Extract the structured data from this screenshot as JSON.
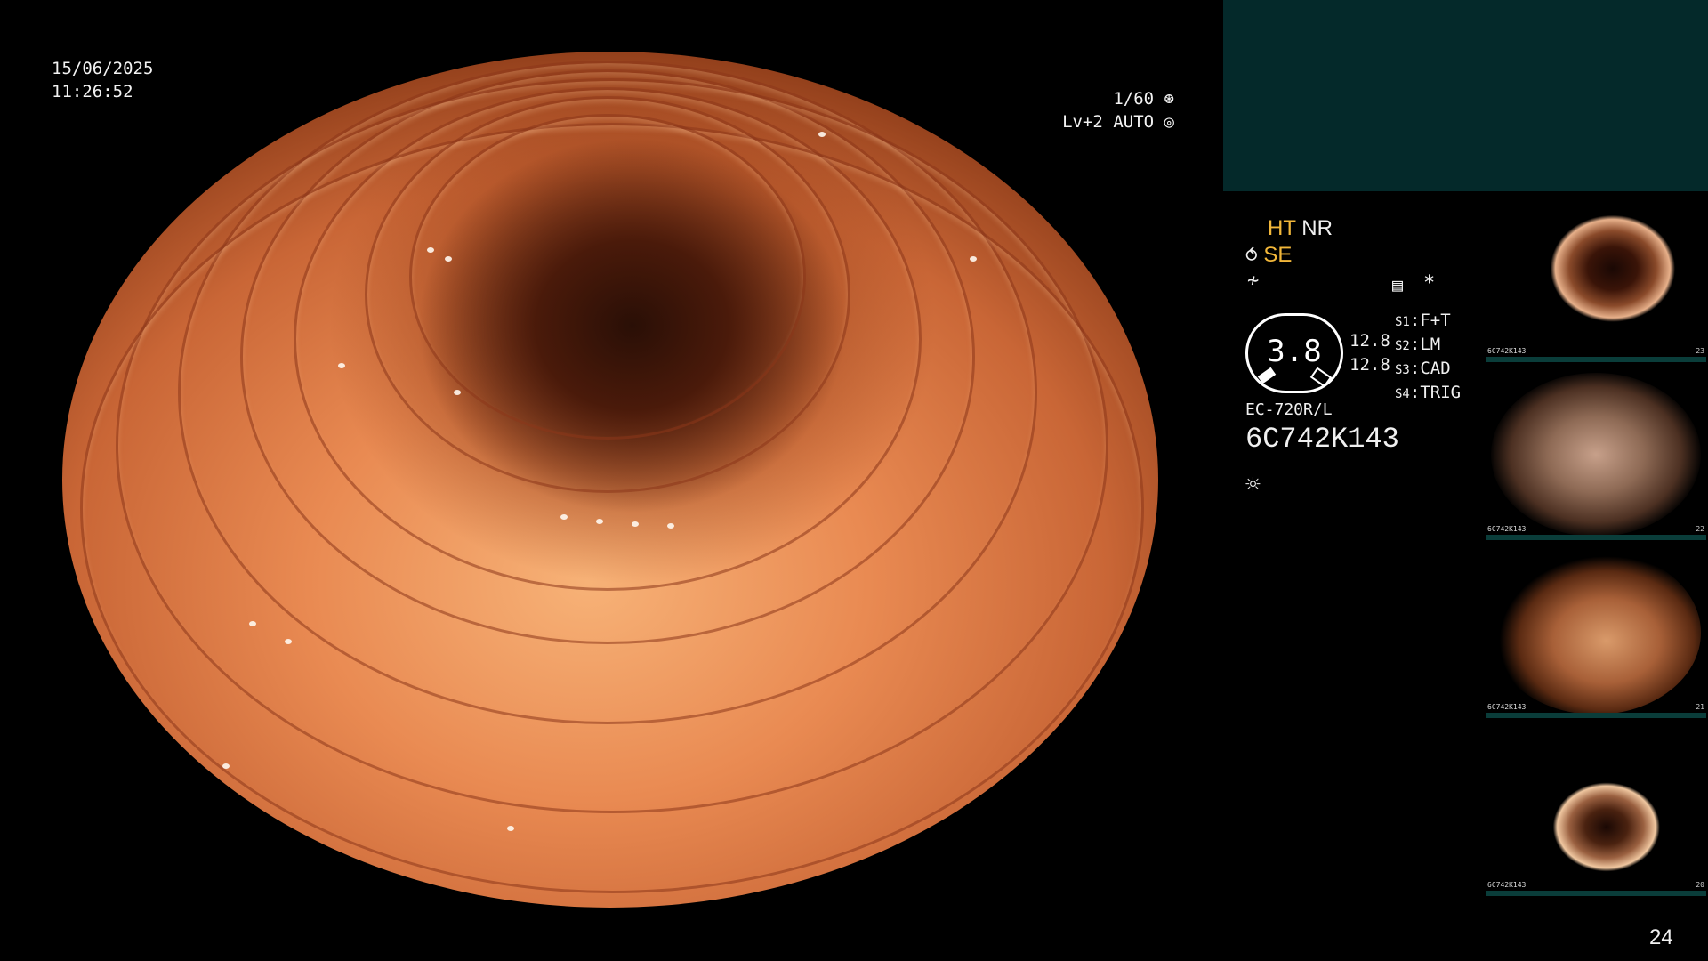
{
  "osd_left": {
    "date": "15/06/2025",
    "time": "11:26:52"
  },
  "osd_right": {
    "shutter": "1/60",
    "level": "Lv+2",
    "mode": "AUTO"
  },
  "panel": {
    "row1": {
      "ht": "HT",
      "nr": "NR"
    },
    "row2": {
      "se": "SE"
    },
    "zoom_value": "3.8",
    "zoom_a": "12.8",
    "zoom_b": "12.8",
    "switches": [
      {
        "key": "S1",
        "value": "F+T"
      },
      {
        "key": "S2",
        "value": "LM"
      },
      {
        "key": "S3",
        "value": "CAD"
      },
      {
        "key": "S4",
        "value": "TRIG"
      }
    ],
    "asterisk": "*",
    "scope_model": "EC-720R/L",
    "serial": "6C742K143"
  },
  "thumbnails": [
    {
      "number": "23",
      "id": "6C742K143"
    },
    {
      "number": "22",
      "id": "6C742K143"
    },
    {
      "number": "21",
      "id": "6C742K143"
    },
    {
      "number": "20",
      "id": "6C742K143"
    }
  ],
  "page_number": "24",
  "colors": {
    "accent_yellow": "#f2b73a",
    "status_box": "#04292a",
    "thumb_bar": "#0a3d3a"
  }
}
